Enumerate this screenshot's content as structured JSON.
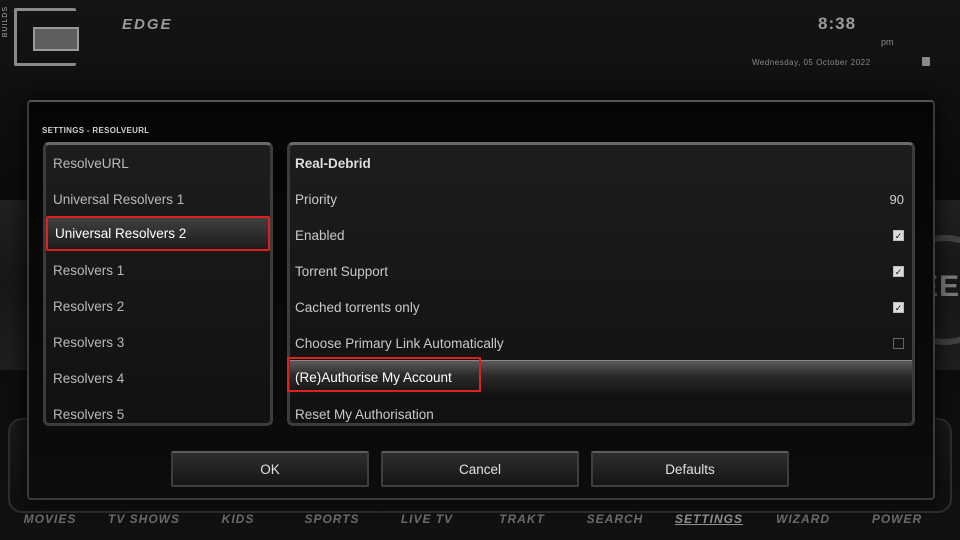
{
  "header": {
    "logo_side_text": "BUILDS",
    "skin_name": "EDGE",
    "time": "8:38",
    "ampm": "pm",
    "date": "Wednesday, 05 October 2022"
  },
  "dialog": {
    "title": "SETTINGS - RESOLVEURL",
    "categories": [
      "ResolveURL",
      "Universal Resolvers 1",
      "Universal Resolvers 2",
      "Resolvers 1",
      "Resolvers 2",
      "Resolvers 3",
      "Resolvers 4",
      "Resolvers 5"
    ],
    "active_category": "Universal Resolvers 2",
    "settings": {
      "section_header": "Real-Debrid",
      "priority_label": "Priority",
      "priority_value": "90",
      "enabled_label": "Enabled",
      "enabled_checked": true,
      "torrent_label": "Torrent Support",
      "torrent_checked": true,
      "cached_label": "Cached torrents only",
      "cached_checked": true,
      "auto_link_label": "Choose Primary Link Automatically",
      "auto_link_checked": false,
      "reauthorise_label": "(Re)Authorise My Account",
      "reset_label": "Reset My Authorisation"
    },
    "buttons": {
      "ok": "OK",
      "cancel": "Cancel",
      "defaults": "Defaults"
    }
  },
  "bottom_menu": [
    "MOVIES",
    "TV SHOWS",
    "KIDS",
    "SPORTS",
    "LIVE TV",
    "TRAKT",
    "SEARCH",
    "SETTINGS",
    "WIZARD",
    "POWER"
  ],
  "bottom_menu_current": "SETTINGS",
  "background_text": "EE",
  "colors": {
    "highlight_outline": "#e02020"
  }
}
